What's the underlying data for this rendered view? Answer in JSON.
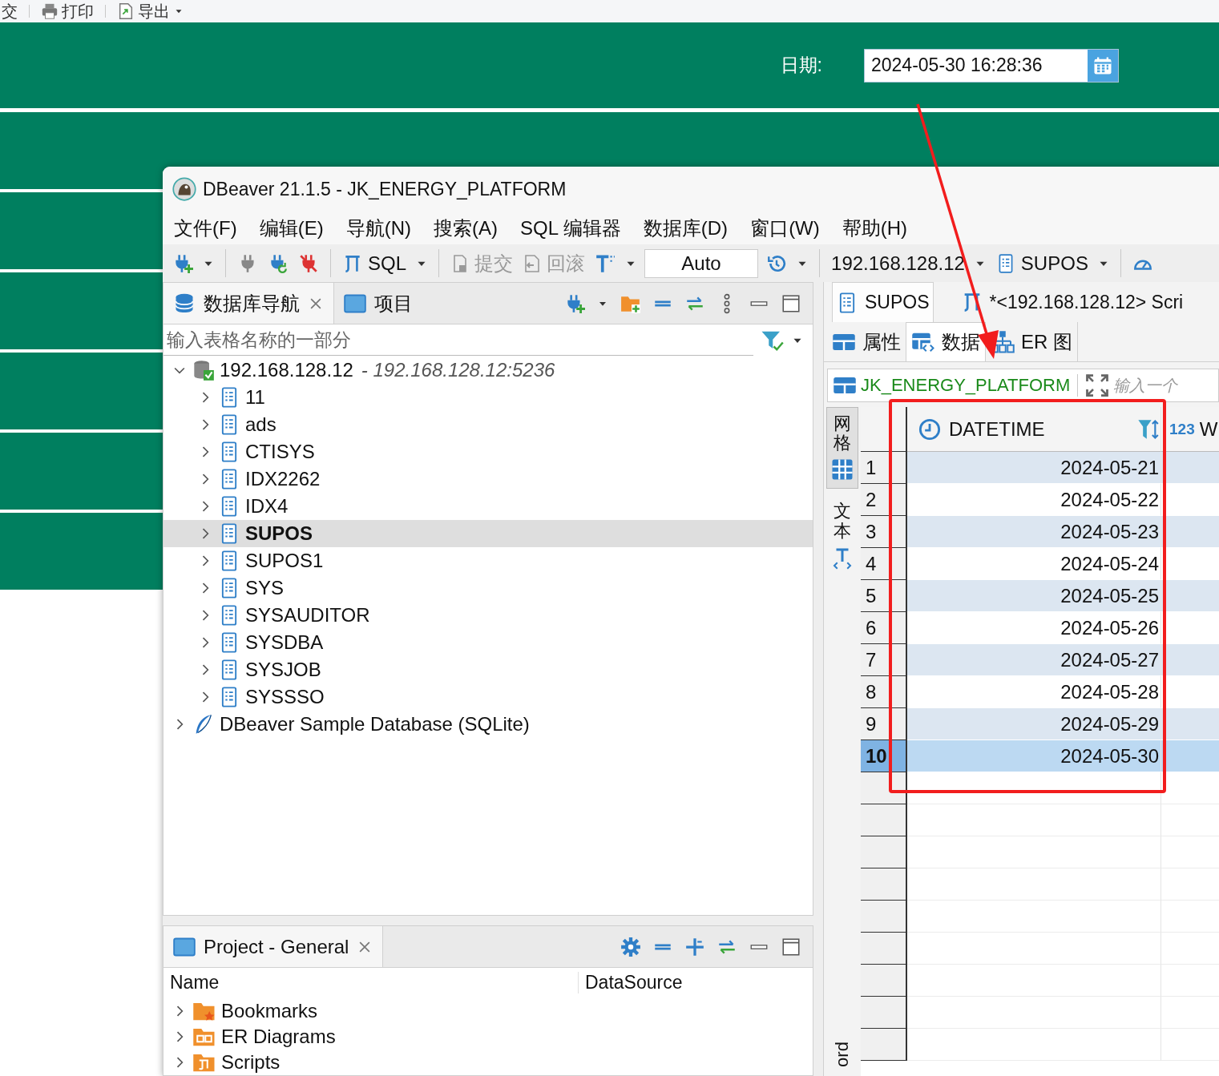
{
  "background_page": {
    "toolbar_items": [
      {
        "label": "交",
        "kind": "text"
      },
      {
        "label": "打印",
        "kind": "print"
      },
      {
        "label": "导出",
        "kind": "export"
      }
    ],
    "date_label": "日期:",
    "date_value": "2024-05-30 16:28:36"
  },
  "window": {
    "title": "DBeaver 21.1.5 - JK_ENERGY_PLATFORM"
  },
  "menu": [
    "文件(F)",
    "编辑(E)",
    "导航(N)",
    "搜索(A)",
    "SQL 编辑器",
    "数据库(D)",
    "窗口(W)",
    "帮助(H)"
  ],
  "toolbar": {
    "sql_label": "SQL",
    "actions": [
      {
        "label": "提交",
        "kind": "commit",
        "disabled": true
      },
      {
        "label": "回滚",
        "kind": "rollback",
        "disabled": true
      }
    ],
    "transaction_mode": "Auto",
    "connection": "192.168.128.12",
    "schema": "SUPOS"
  },
  "navigator": {
    "tabs": [
      {
        "label": "数据库导航",
        "selected": true,
        "closable": true
      },
      {
        "label": "项目",
        "selected": false,
        "closable": false
      }
    ],
    "filter_placeholder": "输入表格名称的一部分",
    "tree": [
      {
        "label": "192.168.128.12",
        "detail": "- 192.168.128.12:5236",
        "kind": "connection",
        "expanded": true,
        "children": [
          {
            "label": "11",
            "selected": false
          },
          {
            "label": "ads",
            "selected": false
          },
          {
            "label": "CTISYS",
            "selected": false
          },
          {
            "label": "IDX2262",
            "selected": false
          },
          {
            "label": "IDX4",
            "selected": false
          },
          {
            "label": "SUPOS",
            "selected": true
          },
          {
            "label": "SUPOS1",
            "selected": false
          },
          {
            "label": "SYS",
            "selected": false
          },
          {
            "label": "SYSAUDITOR",
            "selected": false
          },
          {
            "label": "SYSDBA",
            "selected": false
          },
          {
            "label": "SYSJOB",
            "selected": false
          },
          {
            "label": "SYSSSO",
            "selected": false
          }
        ]
      },
      {
        "label": "DBeaver Sample Database (SQLite)",
        "kind": "sqlite",
        "expanded": false
      }
    ]
  },
  "project": {
    "title": "Project - General",
    "columns": [
      "Name",
      "DataSource"
    ],
    "items": [
      {
        "label": "Bookmarks",
        "kind": "bookmarks"
      },
      {
        "label": "ER Diagrams",
        "kind": "diagrams"
      },
      {
        "label": "Scripts",
        "kind": "scripts"
      }
    ]
  },
  "editor": {
    "tabs": [
      {
        "label": "SUPOS",
        "kind": "schema",
        "selected": true
      },
      {
        "label": "*<192.168.128.12> Scri",
        "kind": "script",
        "selected": false
      }
    ],
    "subtabs": [
      {
        "label": "属性",
        "kind": "properties",
        "selected": false
      },
      {
        "label": "数据",
        "kind": "data",
        "selected": true
      },
      {
        "label": "ER 图",
        "kind": "er",
        "selected": false
      }
    ],
    "table_name": "JK_ENERGY_PLATFORM",
    "filter_placeholder": "输入一个",
    "view_modes": [
      {
        "label": "网格",
        "kind": "grid",
        "selected": true
      },
      {
        "label": "文本",
        "kind": "text",
        "selected": false
      }
    ],
    "record_label": "ord",
    "columns": [
      {
        "name": "DATETIME",
        "kind": "datetime"
      },
      {
        "name": "W",
        "kind": "number",
        "type_label": "123"
      }
    ],
    "rows": [
      {
        "number": "1",
        "value": "2024-05-21",
        "selected": false
      },
      {
        "number": "2",
        "value": "2024-05-22",
        "selected": false
      },
      {
        "number": "3",
        "value": "2024-05-23",
        "selected": false
      },
      {
        "number": "4",
        "value": "2024-05-24",
        "selected": false
      },
      {
        "number": "5",
        "value": "2024-05-25",
        "selected": false
      },
      {
        "number": "6",
        "value": "2024-05-26",
        "selected": false
      },
      {
        "number": "7",
        "value": "2024-05-27",
        "selected": false
      },
      {
        "number": "8",
        "value": "2024-05-28",
        "selected": false
      },
      {
        "number": "9",
        "value": "2024-05-29",
        "selected": false
      },
      {
        "number": "10",
        "value": "2024-05-30",
        "selected": true
      }
    ]
  }
}
